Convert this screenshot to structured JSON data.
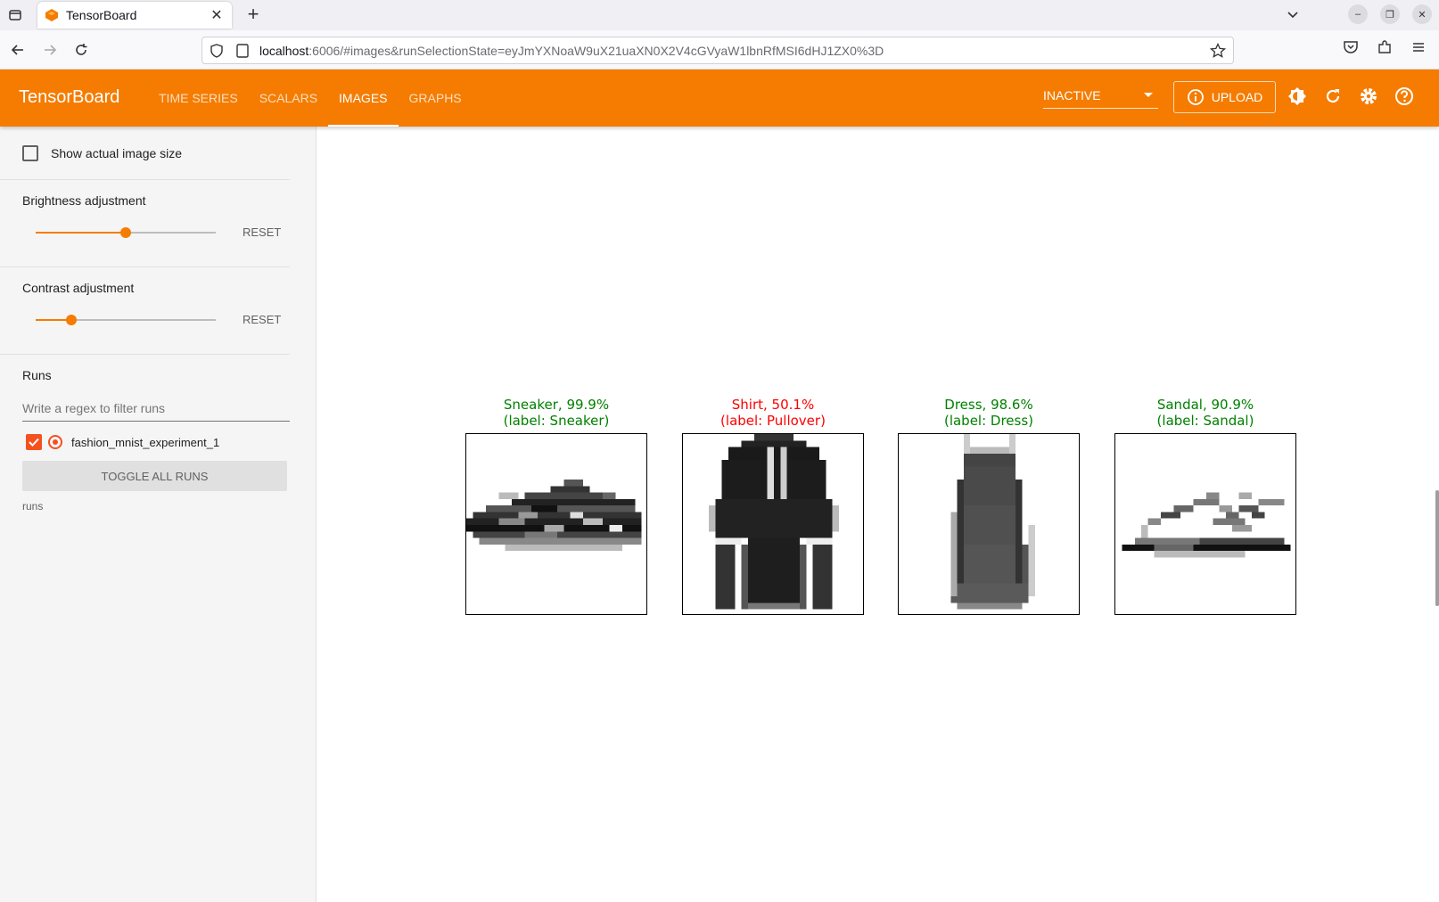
{
  "browser": {
    "tab_title": "TensorBoard",
    "url_host": "localhost",
    "url_rest": ":6006/#images&runSelectionState=eyJmYXNoaW9uX21uaXN0X2V4cGVyaW1lbnRfMSI6dHJ1ZX0%3D"
  },
  "header": {
    "title": "TensorBoard",
    "tabs": [
      {
        "label": "TIME SERIES"
      },
      {
        "label": "SCALARS"
      },
      {
        "label": "IMAGES"
      },
      {
        "label": "GRAPHS"
      }
    ],
    "active_tab": "IMAGES",
    "status_select": "INACTIVE",
    "upload_label": "UPLOAD",
    "accent_color": "#f57c00"
  },
  "sidebar": {
    "show_actual_size_label": "Show actual image size",
    "brightness": {
      "label": "Brightness adjustment",
      "value_fraction": 0.5,
      "reset_label": "RESET"
    },
    "contrast": {
      "label": "Contrast adjustment",
      "value_fraction": 0.2,
      "reset_label": "RESET"
    },
    "runs": {
      "title": "Runs",
      "filter_placeholder": "Write a regex to filter runs",
      "items": [
        {
          "name": "fashion_mnist_experiment_1",
          "checked": true
        }
      ],
      "toggle_all_label": "TOGGLE ALL RUNS",
      "footer": "runs"
    }
  },
  "predictions": [
    {
      "title_line1": "Sneaker, 99.9%",
      "title_line2": "(label: Sneaker)",
      "correct": true,
      "icon": "sneaker"
    },
    {
      "title_line1": "Shirt, 50.1%",
      "title_line2": "(label: Pullover)",
      "correct": false,
      "icon": "shirt"
    },
    {
      "title_line1": "Dress, 98.6%",
      "title_line2": "(label: Dress)",
      "correct": true,
      "icon": "dress"
    },
    {
      "title_line1": "Sandal, 90.9%",
      "title_line2": "(label: Sandal)",
      "correct": true,
      "icon": "sandal"
    }
  ],
  "colors": {
    "correct": "#008000",
    "incorrect": "#ff0000"
  }
}
